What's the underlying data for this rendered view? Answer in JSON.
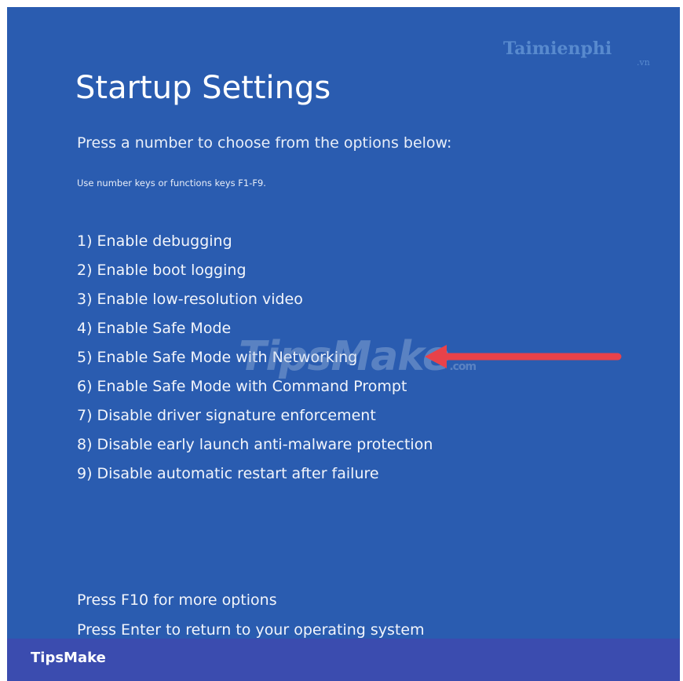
{
  "screen": {
    "title": "Startup Settings",
    "subtitle": "Press a number to choose from the options below:",
    "hint": "Use number keys or functions keys F1-F9.",
    "options": [
      "1) Enable debugging",
      "2) Enable boot logging",
      "3) Enable low-resolution video",
      "4) Enable Safe Mode",
      "5) Enable Safe Mode with Networking",
      "6) Enable Safe Mode with Command Prompt",
      "7) Disable driver signature enforcement",
      "8) Disable early launch anti-malware protection",
      "9) Disable automatic restart after failure"
    ],
    "footer_more": "Press F10 for more options",
    "footer_return": "Press Enter to return to your operating system"
  },
  "watermark_logo": {
    "main": "Taimienphi",
    "suffix": ".vn"
  },
  "watermark_center": {
    "main": "TipsMake",
    "suffix": ".com"
  },
  "brand_bar": {
    "label": "TipsMake"
  },
  "annotation": {
    "arrow_color": "#e8424a",
    "highlighted_option": "5) Enable Safe Mode with Networking"
  },
  "colors": {
    "screen_background": "#2a5cb0",
    "brand_bar_background": "#3b4caf",
    "text": "#ffffff"
  }
}
